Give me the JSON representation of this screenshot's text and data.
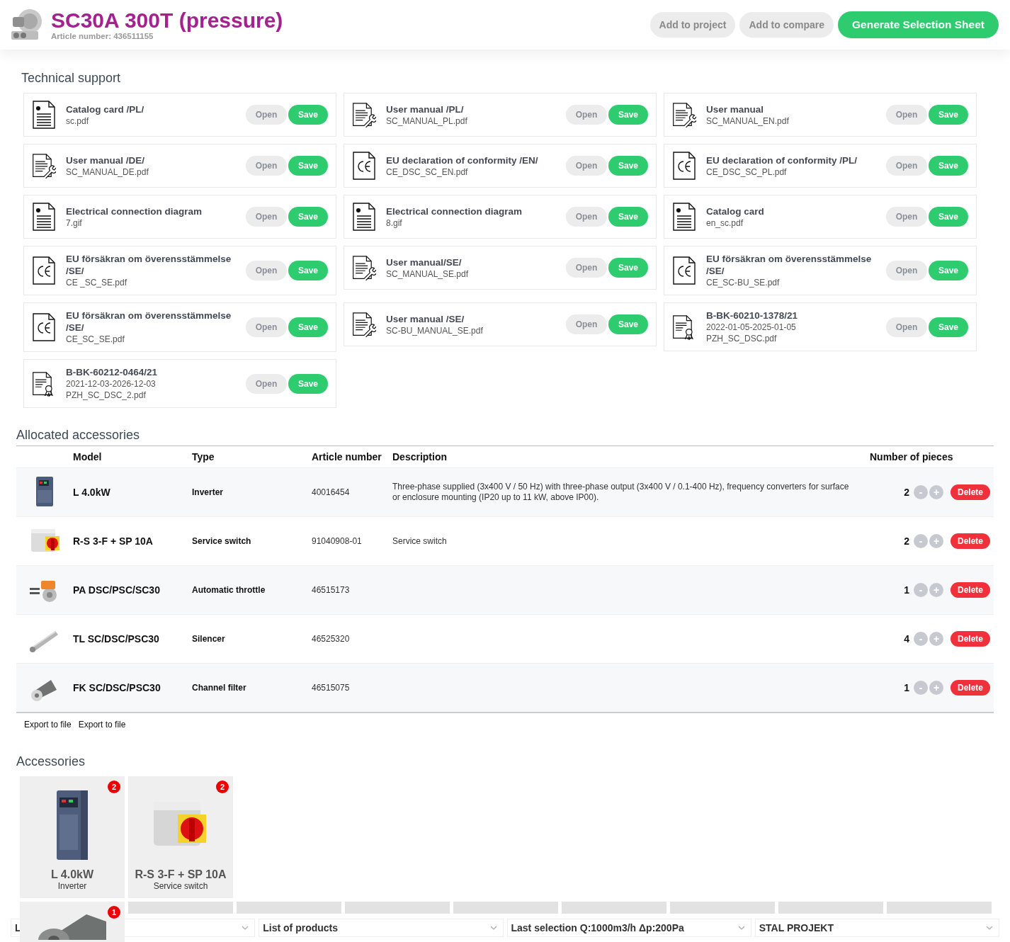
{
  "header": {
    "title": "SC30A 300T (pressure)",
    "article_number": "Article number: 436511155",
    "buttons": [
      {
        "label": "Add to project",
        "kind": "secondary"
      },
      {
        "label": "Add to compare",
        "kind": "secondary"
      },
      {
        "label": "Generate Selection Sheet",
        "kind": "primary"
      }
    ]
  },
  "technical_support": {
    "title": "Technical support",
    "documents": [
      {
        "kind": "catalog",
        "title": "Catalog card /PL/",
        "lines": [
          "sc.pdf"
        ],
        "open": "Open",
        "save": "Save"
      },
      {
        "kind": "manual",
        "title": "User manual /PL/",
        "lines": [
          "SC_MANUAL_PL.pdf"
        ],
        "open": "Open",
        "save": "Save"
      },
      {
        "kind": "manual",
        "title": "User manual",
        "lines": [
          "SC_MANUAL_EN.pdf"
        ],
        "open": "Open",
        "save": "Save"
      },
      {
        "kind": "manual",
        "title": "User manual /DE/",
        "lines": [
          "SC_MANUAL_DE.pdf"
        ],
        "open": "Open",
        "save": "Save"
      },
      {
        "kind": "ce",
        "title": "EU declaration of conformity /EN/",
        "lines": [
          "CE_DSC_SC_EN.pdf"
        ],
        "open": "Open",
        "save": "Save"
      },
      {
        "kind": "ce",
        "title": "EU declaration of conformity /PL/",
        "lines": [
          "CE_DSC_SC_PL.pdf"
        ],
        "open": "Open",
        "save": "Save"
      },
      {
        "kind": "catalog",
        "title": "Electrical connection diagram",
        "lines": [
          "7.gif"
        ],
        "open": "Open",
        "save": "Save"
      },
      {
        "kind": "catalog",
        "title": "Electrical connection diagram",
        "lines": [
          "8.gif"
        ],
        "open": "Open",
        "save": "Save"
      },
      {
        "kind": "catalog",
        "title": "Catalog card",
        "lines": [
          "en_sc.pdf"
        ],
        "open": "Open",
        "save": "Save"
      },
      {
        "kind": "ce",
        "title": "EU försäkran om överensstämmelse /SE/",
        "lines": [
          "CE _SC_SE.pdf"
        ],
        "open": "Open",
        "save": "Save"
      },
      {
        "kind": "manual",
        "title": "User manual/SE/",
        "lines": [
          "SC_MANUAL_SE.pdf"
        ],
        "open": "Open",
        "save": "Save"
      },
      {
        "kind": "ce",
        "title": "EU försäkran om överensstämmelse /SE/",
        "lines": [
          "CE_SC-BU_SE.pdf"
        ],
        "open": "Open",
        "save": "Save"
      },
      {
        "kind": "ce",
        "title": "EU försäkran om överensstämmelse /SE/",
        "lines": [
          "CE_SC_SE.pdf"
        ],
        "open": "Open",
        "save": "Save"
      },
      {
        "kind": "manual",
        "title": "User manual /SE/",
        "lines": [
          "SC-BU_MANUAL_SE.pdf"
        ],
        "open": "Open",
        "save": "Save"
      },
      {
        "kind": "certificate",
        "title": "B-BK-60210-1378/21",
        "lines": [
          "2022-01-05-2025-01-05",
          "PZH_SC_DSC.pdf"
        ],
        "open": "Open",
        "save": "Save"
      },
      {
        "kind": "certificate",
        "title": "B-BK-60212-0464/21",
        "lines": [
          "2021-12-03-2026-12-03",
          "PZH_SC_DSC_2.pdf"
        ],
        "open": "Open",
        "save": "Save"
      }
    ]
  },
  "allocated_accessories": {
    "title": "Allocated accessories",
    "columns": [
      "Model",
      "Type",
      "Article number",
      "Description",
      "Number of pieces"
    ],
    "rows": [
      {
        "model": "L 4.0kW",
        "type": "Inverter",
        "article_number": "40016454",
        "description": "Three-phase supplied (3x400 V / 50 Hz) with three-phase output (3x400 V / 0.1-400 Hz), frequency converters for surface or enclosure mounting (IP20 up to 11 kW, above IP00).",
        "pieces": "2",
        "decrement": "-",
        "increment": "+",
        "delete": "Delete"
      },
      {
        "model": "R-S 3-F + SP 10A",
        "type": "Service switch",
        "article_number": "91040908-01",
        "description": "Service switch",
        "pieces": "2",
        "decrement": "-",
        "increment": "+",
        "delete": "Delete"
      },
      {
        "model": "PA DSC/PSC/SC30",
        "type": "Automatic throttle",
        "article_number": "46515173",
        "pieces": "1",
        "decrement": "-",
        "increment": "+",
        "delete": "Delete"
      },
      {
        "model": "TL SC/DSC/PSC30",
        "type": "Silencer",
        "article_number": "46525320",
        "pieces": "4",
        "decrement": "-",
        "increment": "+",
        "delete": "Delete"
      },
      {
        "model": "FK SC/DSC/PSC30",
        "type": "Channel filter",
        "article_number": "46515075",
        "pieces": "1",
        "decrement": "-",
        "increment": "+",
        "delete": "Delete"
      }
    ],
    "export_links": [
      "Export to file",
      "Export to file"
    ]
  },
  "accessories": {
    "title": "Accessories",
    "cards": [
      {
        "name": "L 4.0kW",
        "type": "Inverter",
        "badge": "2"
      },
      {
        "name": "R-S 3-F + SP 10A",
        "type": "Service switch",
        "badge": "2"
      },
      {
        "badge": "1"
      }
    ]
  },
  "bottom_bar": {
    "selects": [
      "L",
      "List of products",
      "Last selection Q:1000m3/h Δp:200Pa",
      "STAL PROJEKT"
    ]
  }
}
